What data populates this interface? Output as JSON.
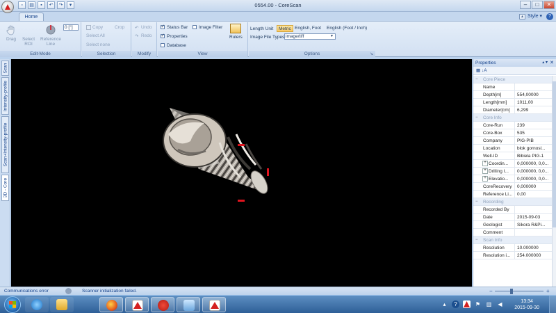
{
  "window": {
    "title": "0554.00 - CoreScan",
    "controls": {
      "minimize": "–",
      "maximize": "□",
      "close": "✕"
    }
  },
  "quick_access": [
    "new-icon",
    "open-icon",
    "save-icon",
    "undo-icon",
    "redo-icon",
    "dropdown-icon"
  ],
  "ribbon": {
    "tabs": [
      "Home"
    ],
    "style_label": "Style",
    "help_label": "?",
    "groups": {
      "edit_mode": {
        "label": "Edit-Mode",
        "drag": "Drag",
        "select_roi": "Select ROI",
        "reference_line": "Reference Line",
        "angle_value": "0 [°]"
      },
      "selection": {
        "label": "Selection",
        "copy": "Copy",
        "crop": "Crop",
        "select_all": "Select All",
        "select_none": "Select none"
      },
      "modify": {
        "label": "Modify",
        "undo": "Undo",
        "redo": "Redo"
      },
      "view": {
        "label": "View",
        "status_bar": {
          "label": "Status Bar",
          "checked": true
        },
        "image_filter": {
          "label": "Image Filter",
          "checked": false
        },
        "properties": {
          "label": "Properties",
          "checked": true
        },
        "database": {
          "label": "Database",
          "checked": false
        },
        "rulers": "Rulers"
      },
      "options": {
        "label": "Options",
        "length_unit_label": "Length Unit",
        "units": [
          "Metric",
          "English, Foot",
          "English (Foot / Inch)"
        ],
        "active_unit": "Metric",
        "image_file_types_label": "Image File Types",
        "image_file_type_value": "image/tiff"
      }
    }
  },
  "left_tabs": [
    "Scan",
    "Intensity-profile",
    "Scan+Intensity-profile",
    "3D - Core"
  ],
  "active_left_tab": "3D - Core",
  "properties": {
    "title": "Properties",
    "pin": "▴ ▾",
    "close": "✕",
    "toolbar": "▦  ↓A",
    "sections": [
      {
        "name": "Core Piece",
        "rows": [
          {
            "key": "Name",
            "value": ""
          },
          {
            "key": "Depth[m]",
            "value": "554,00000"
          },
          {
            "key": "Length[mm]",
            "value": "1011,00"
          },
          {
            "key": "Diameter[cm]",
            "value": "6,299"
          }
        ]
      },
      {
        "name": "Core Info",
        "rows": [
          {
            "key": "Core-Run",
            "value": "239"
          },
          {
            "key": "Core-Box",
            "value": "535"
          },
          {
            "key": "Company",
            "value": "PIG-PIB"
          },
          {
            "key": "Location",
            "value": "blok gornosl..."
          },
          {
            "key": "Well-ID",
            "value": "Bibiela PIG-1"
          },
          {
            "key": "Coordin...",
            "value": "0,000000, 0,0...",
            "expandable": true
          },
          {
            "key": "Drilling I...",
            "value": "0,000000, 0,0...",
            "expandable": true
          },
          {
            "key": "Elevatio...",
            "value": "0,000000, 0,0...",
            "expandable": true
          },
          {
            "key": "CoreRecovery",
            "value": "0,000000"
          },
          {
            "key": "Reference Li...",
            "value": "0,00"
          }
        ]
      },
      {
        "name": "Recording",
        "rows": [
          {
            "key": "Recorded By",
            "value": ""
          },
          {
            "key": "Date",
            "value": "2015-09-03"
          },
          {
            "key": "Geologist",
            "value": "Sikora R&Pi..."
          },
          {
            "key": "Comment",
            "value": ""
          }
        ]
      },
      {
        "name": "Scan Info",
        "rows": [
          {
            "key": "Resolution",
            "value": "10.000000"
          },
          {
            "key": "Resolution i...",
            "value": "254.000000"
          }
        ]
      }
    ]
  },
  "statusbar": {
    "left": "Communications error",
    "message": "Scanner initialization failed.",
    "zoom_minus": "−",
    "zoom_plus": "+"
  },
  "taskbar": {
    "items": [
      "internet-explorer-icon",
      "file-explorer-icon",
      "firefox-icon",
      "corescan-icon",
      "pdf-icon",
      "network-icon",
      "corescan-active-icon"
    ],
    "time": "13:34",
    "date": "2015-09-30"
  },
  "colors": {
    "ribbon": "#d2e0f2",
    "viewport": "#000000",
    "accent": "#f9c865",
    "marker": "#e0141e",
    "taskbar": "#2e5f97"
  }
}
